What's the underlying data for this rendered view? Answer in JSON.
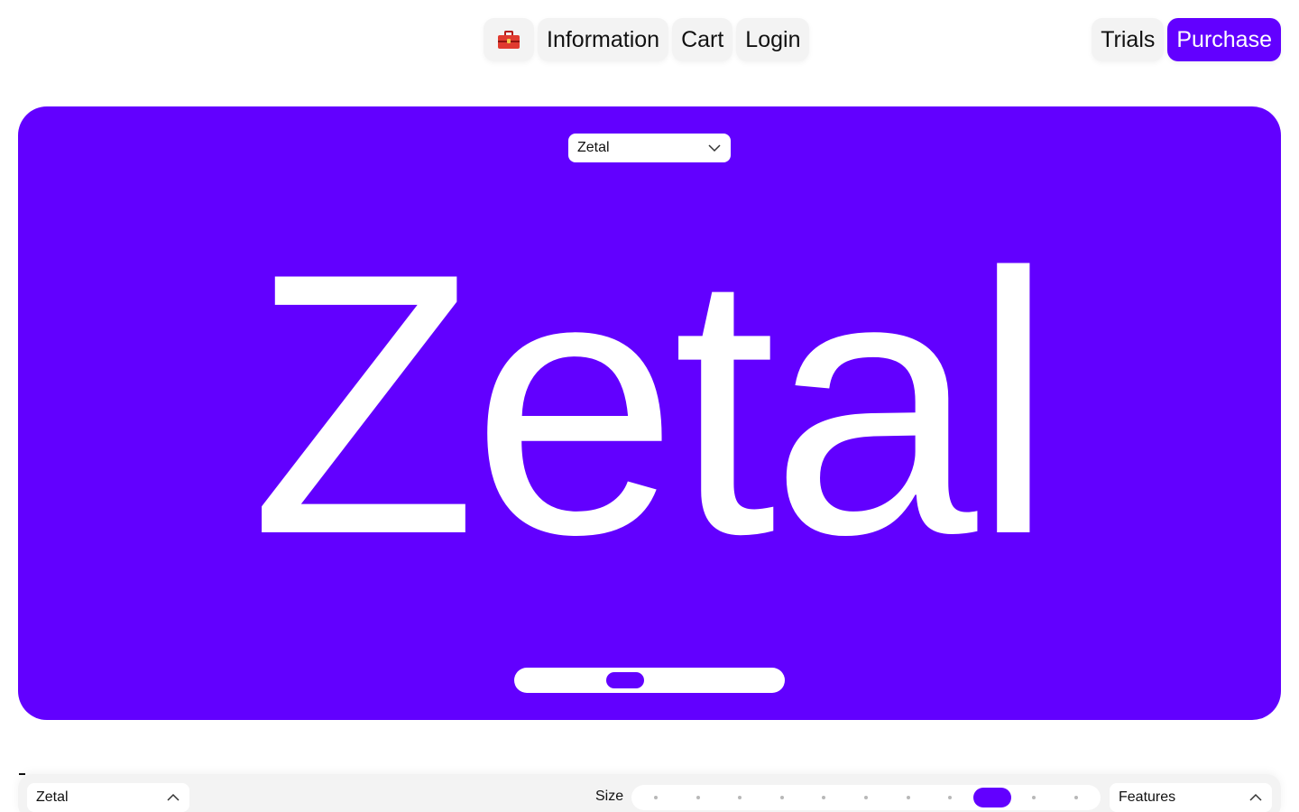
{
  "nav": {
    "logo_icon": "toolbox-icon",
    "items": [
      {
        "label": "Information"
      },
      {
        "label": "Cart"
      },
      {
        "label": "Login"
      }
    ],
    "trials_label": "Trials",
    "purchase_label": "Purchase"
  },
  "hero": {
    "font_select_value": "Zetal",
    "specimen_text": "Zetal",
    "background_color": "#6200ff",
    "slider_value": 0.39
  },
  "toolbar": {
    "font_select_value": "Zetal",
    "size_label": "Size",
    "size_steps": 11,
    "size_selected_step": 9,
    "features_label": "Features"
  },
  "colors": {
    "accent": "#6200ff",
    "pill_bg": "#f3f3f3",
    "text": "#111111"
  }
}
